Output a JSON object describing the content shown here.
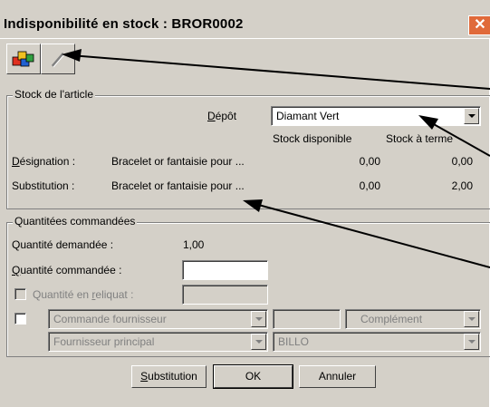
{
  "window": {
    "title": "Indisponibilité en stock : BROR0002"
  },
  "toolbar": {
    "btn1_icon": "colored-blocks-icon",
    "btn2_icon": "pen-icon"
  },
  "stock": {
    "legend": "Stock de l'article",
    "depot_label": "Dépôt",
    "depot_value": "Diamant Vert",
    "col_available": "Stock disponible",
    "col_term": "Stock à terme",
    "rows": [
      {
        "label": "Désignation :",
        "text": "Bracelet or fantaisie pour ...",
        "available": "0,00",
        "term": "0,00"
      },
      {
        "label": "Substitution :",
        "text": "Bracelet or fantaisie pour ...",
        "available": "0,00",
        "term": "2,00"
      }
    ]
  },
  "quantities": {
    "legend": "Quantitées commandées",
    "requested_label": "Quantité demandée :",
    "requested_value": "1,00",
    "ordered_label": "Quantité commandée :",
    "ordered_value": "",
    "reliquat_label": "Quantité en reliquat :",
    "reliquat_value": "",
    "supplier_order": "Commande fournisseur",
    "complement": "Complément",
    "main_supplier": "Fournisseur principal",
    "supplier_name": "BILLO"
  },
  "buttons": {
    "substitution": "Substitution",
    "ok": "OK",
    "cancel": "Annuler"
  },
  "colors": {
    "face": "#d4d0c8",
    "close": "#e06a3a"
  }
}
